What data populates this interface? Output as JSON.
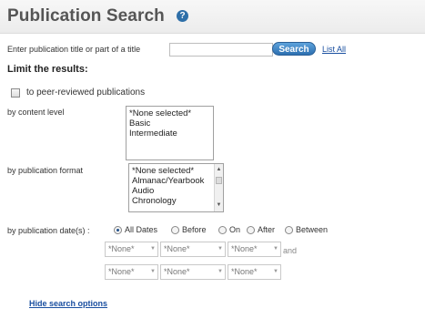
{
  "header": {
    "title": "Publication Search",
    "help_icon": "question-mark-icon",
    "help_glyph": "?"
  },
  "search": {
    "title_label": "Enter publication title or part of a title",
    "title_value": "",
    "search_button": "Search",
    "list_all_link": "List All"
  },
  "limit": {
    "heading": "Limit the results:",
    "peer_reviewed_label": "to peer-reviewed publications",
    "peer_reviewed_checked": false
  },
  "content_level": {
    "label": "by content level",
    "options": [
      "*None selected*",
      "Basic",
      "Intermediate"
    ]
  },
  "publication_format": {
    "label": "by publication format",
    "options": [
      "*None selected*",
      "Almanac/Yearbook",
      "Audio",
      "Chronology"
    ]
  },
  "publication_dates": {
    "label": "by publication date(s) :",
    "options": [
      "All Dates",
      "Before",
      "On",
      "After",
      "Between"
    ],
    "selected": "All Dates",
    "and_label": "and",
    "row1": [
      "*None*",
      "*None*",
      "*None*"
    ],
    "row2": [
      "*None*",
      "*None*",
      "*None*"
    ]
  },
  "footer": {
    "hide_link": "Hide search options"
  }
}
